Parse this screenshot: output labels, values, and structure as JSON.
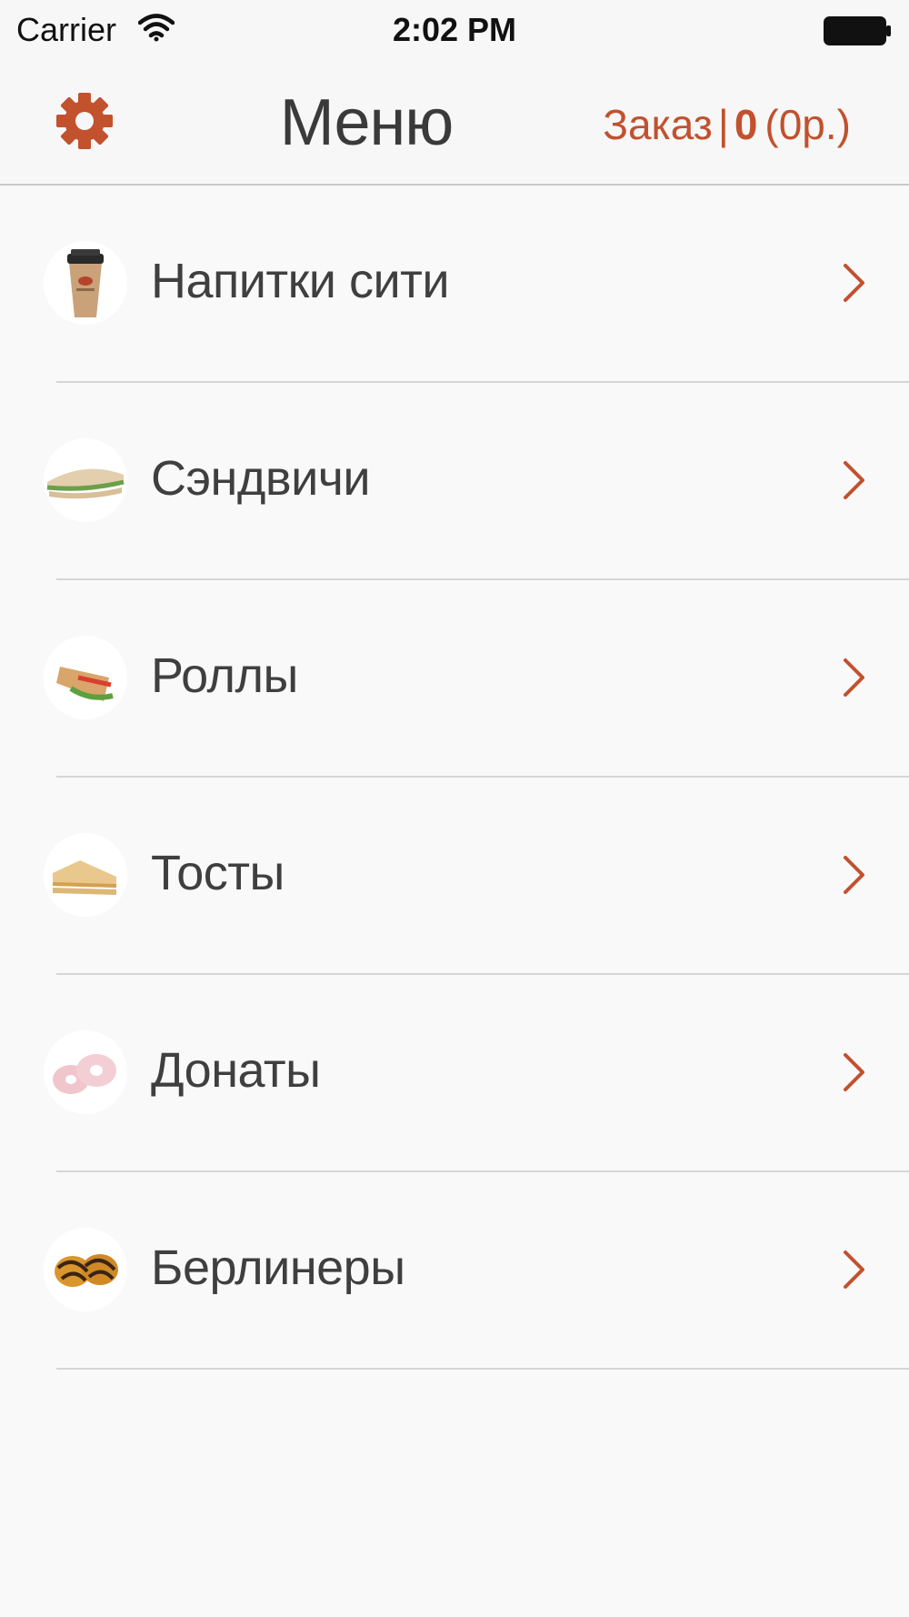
{
  "status_bar": {
    "carrier": "Carrier",
    "time": "2:02 PM",
    "icons": [
      "wifi-icon",
      "battery-icon"
    ]
  },
  "nav_bar": {
    "title": "Меню",
    "settings_icon": "gear-icon",
    "order": {
      "label": "Заказ",
      "separator": "|",
      "count": "0",
      "sum": "(0р.)"
    }
  },
  "menu": {
    "items": [
      {
        "label": "Напитки сити",
        "image": "coffee-cup-image"
      },
      {
        "label": "Сэндвичи",
        "image": "sandwich-image"
      },
      {
        "label": "Роллы",
        "image": "roll-image"
      },
      {
        "label": "Тосты",
        "image": "toast-image"
      },
      {
        "label": "Донаты",
        "image": "donut-image"
      },
      {
        "label": "Берлинеры",
        "image": "berliner-image"
      }
    ],
    "chevron_icon": "chevron-right-icon"
  },
  "colors": {
    "accent": "#c2512e",
    "background": "#f9f9f9",
    "separator": "#d6d6d6",
    "text": "#3f3f3f"
  }
}
